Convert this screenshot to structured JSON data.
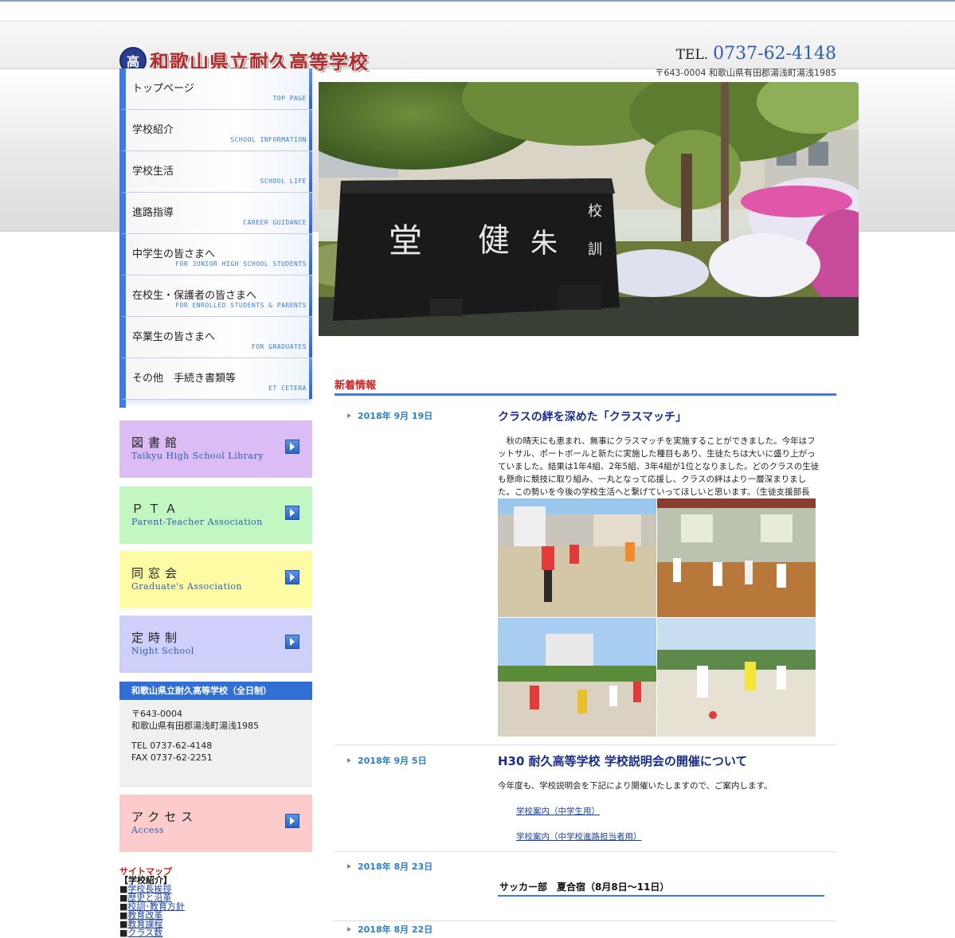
{
  "header": {
    "emblem_char": "高",
    "school_name": "和歌山県立耐久高等学校",
    "tel_label": "TEL.",
    "tel_number": "0737-62-4148",
    "address": "〒643-0004 和歌山県有田郡湯浅町湯浅1985"
  },
  "nav": {
    "items": [
      {
        "jp": "トップページ",
        "en": "TOP PAGE"
      },
      {
        "jp": "学校紹介",
        "en": "SCHOOL INFORMATION"
      },
      {
        "jp": "学校生活",
        "en": "SCHOOL LIFE"
      },
      {
        "jp": "進路指導",
        "en": "CAREER GUIDANCE"
      },
      {
        "jp": "中学生の皆さまへ",
        "en": "FOR JUNIOR HIGH SCHOOL STUDENTS"
      },
      {
        "jp": "在校生・保護者の皆さまへ",
        "en": "FOR ENROLLED STUDENTS & PARENTS"
      },
      {
        "jp": "卒業生の皆さまへ",
        "en": "FOR GRADUATES"
      },
      {
        "jp": "その他　手続き書類等",
        "en": "ET CETERA"
      }
    ]
  },
  "banners": [
    {
      "jp": "図書館",
      "en": "Taikyu High School Library",
      "color": "#dcbcf5"
    },
    {
      "jp": "ＰＴＡ",
      "en": "Parent-Teacher Association",
      "color": "#c2f7c2"
    },
    {
      "jp": "同窓会",
      "en": "Graduate's Association",
      "color": "#fdfca4"
    },
    {
      "jp": "定時制",
      "en": "Night School",
      "color": "#cfcffb"
    },
    {
      "jp": "アクセス",
      "en": "Access",
      "color": "#fccccc"
    }
  ],
  "info_box": {
    "title": "和歌山県立耐久高等学校（全日制）",
    "postal": "〒643-0004",
    "address": "和歌山県有田郡湯浅町湯浅1985",
    "tel": "TEL 0737-62-4148",
    "fax": "FAX 0737-62-2251"
  },
  "sitemap": {
    "title": "サイトマップ",
    "section": "【学校紹介】",
    "links": [
      "学校長挨拶",
      "歴史と沿革",
      "校訓･教育方針",
      "教育改革",
      "教育課程",
      "クラス数"
    ]
  },
  "hero": {
    "monument_chars": [
      "校",
      "健",
      "朱",
      "訓",
      "堂"
    ]
  },
  "news": {
    "heading": "新着情報",
    "entries": [
      {
        "date": "2018年 9月 19日",
        "title": "クラスの絆を深めた「クラスマッチ」",
        "body": "　秋の晴天にも恵まれ、無事にクラスマッチを実施することができました。今年はフットサル、ポートボールと新たに実施した種目もあり、生徒たちは大いに盛り上がっていました。結果は1年4組、2年5組、3年4組が1位となりました。どのクラスの生徒も懸命に競技に取り組み、一丸となって応援し、クラスの絆はより一層深まりました。この勢いを今後の学校生活へと繋げていってほしいと思います。（生徒支援部長　岸山）"
      },
      {
        "date": "2018年 9月 5日",
        "title": "H30 耐久高等学校 学校説明会の開催について",
        "body": "今年度も、学校説明会を下記により開催いたしますので、ご案内します。",
        "links": [
          "学校案内（中学生用）",
          "学校案内（中学校進路担当者用）"
        ]
      },
      {
        "date": "2018年 8月 23日",
        "title": "サッカー部　夏合宿（8月8日～11日）"
      },
      {
        "date": "2018年 8月 22日"
      }
    ]
  }
}
